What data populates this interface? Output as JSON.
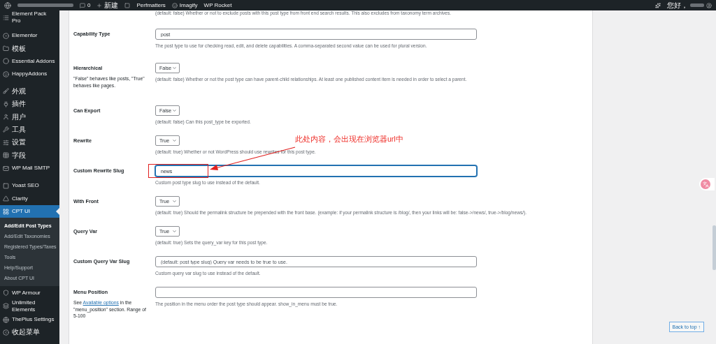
{
  "admin_bar": {
    "items": [
      {
        "kind": "comments",
        "label": "0"
      },
      {
        "kind": "new",
        "label": "新建"
      },
      {
        "kind": "yoast"
      },
      {
        "kind": "text",
        "label": "Perfmatters"
      },
      {
        "kind": "imagify",
        "label": "Imagify"
      },
      {
        "kind": "text",
        "label": "WP Rocket"
      }
    ],
    "greeting": "您好，"
  },
  "sidebar": {
    "items": [
      {
        "label": "Element Pack Pro",
        "selected": false
      },
      {
        "label": "Elementor",
        "selected": false
      },
      {
        "label": "模板",
        "selected": false
      },
      {
        "label": "Essential Addons",
        "selected": false
      },
      {
        "label": "HappyAddons",
        "selected": false
      },
      {
        "label": "外观",
        "selected": false
      },
      {
        "label": "插件",
        "selected": false
      },
      {
        "label": "用户",
        "selected": false
      },
      {
        "label": "工具",
        "selected": false
      },
      {
        "label": "设置",
        "selected": false
      },
      {
        "label": "字段",
        "selected": false
      },
      {
        "label": "WP Mail SMTP",
        "selected": false
      },
      {
        "label": "Yoast SEO",
        "selected": false
      },
      {
        "label": "Clarity",
        "selected": false
      },
      {
        "label": "CPT UI",
        "selected": true,
        "children": [
          {
            "label": "Add/Edit Post Types",
            "selected": true
          },
          {
            "label": "Add/Edit Taxonomies",
            "selected": false
          },
          {
            "label": "Registered Types/Taxes",
            "selected": false
          },
          {
            "label": "Tools",
            "selected": false
          },
          {
            "label": "Help/Support",
            "selected": false
          },
          {
            "label": "About CPT UI",
            "selected": false
          }
        ]
      },
      {
        "label": "WP Armour",
        "selected": false
      },
      {
        "label": "Unlimited Elements",
        "selected": false
      },
      {
        "label": "ThePlus Settings",
        "selected": false
      },
      {
        "label": "收起菜单",
        "selected": false
      }
    ]
  },
  "top_description": "(default: false) Whether or not to exclude posts with this post type from front end search results. This also excludes from taxonomy term archives.",
  "fields": [
    {
      "label": "Capability Type",
      "kind": "text",
      "value": "post",
      "description": "The post type to use for checking read, edit, and delete capabilities. A comma-separated second value can be used for plural version."
    },
    {
      "label": "Hierarchical",
      "note": "\"False\" behaves like posts, \"True\" behaves like pages.",
      "kind": "select",
      "value": "False",
      "description": "(default: false) Whether or not the post type can have parent-child relationships. At least one published content item is needed in order to select a parent."
    },
    {
      "label": "Can Export",
      "kind": "select",
      "value": "False",
      "description": "(default: false) Can this post_type be exported."
    },
    {
      "label": "Rewrite",
      "kind": "select",
      "value": "True",
      "description": "(default: true) Whether or not WordPress should use rewrites for this post type."
    },
    {
      "label": "Custom Rewrite Slug",
      "kind": "text",
      "value": "news",
      "focused": true,
      "description": "Custom post type slug to use instead of the default.",
      "annotation": "此处内容，会出现在浏览器url中"
    },
    {
      "label": "With Front",
      "kind": "select",
      "value": "True",
      "description": "(default: true) Should the permalink structure be prepended with the front base. (example: if your permalink structure is /blog/, then your links will be: false->/news/, true->/blog/news/)."
    },
    {
      "label": "Query Var",
      "kind": "select",
      "value": "True",
      "description": "(default: true) Sets the query_var key for this post type."
    },
    {
      "label": "Custom Query Var Slug",
      "kind": "text",
      "placeholder": "(default: post type slug) Query var needs to be true to use.",
      "description": "Custom query var slug to use instead of the default."
    },
    {
      "label": "Menu Position",
      "note_parts": {
        "before": "See ",
        "link": "Available options",
        "after": " in the \"menu_position\" section. Range of 5-100"
      },
      "kind": "text",
      "description": "The position in the menu order the post type should appear. show_in_menu must be true."
    }
  ],
  "back_to_top": "Back to top ↑"
}
